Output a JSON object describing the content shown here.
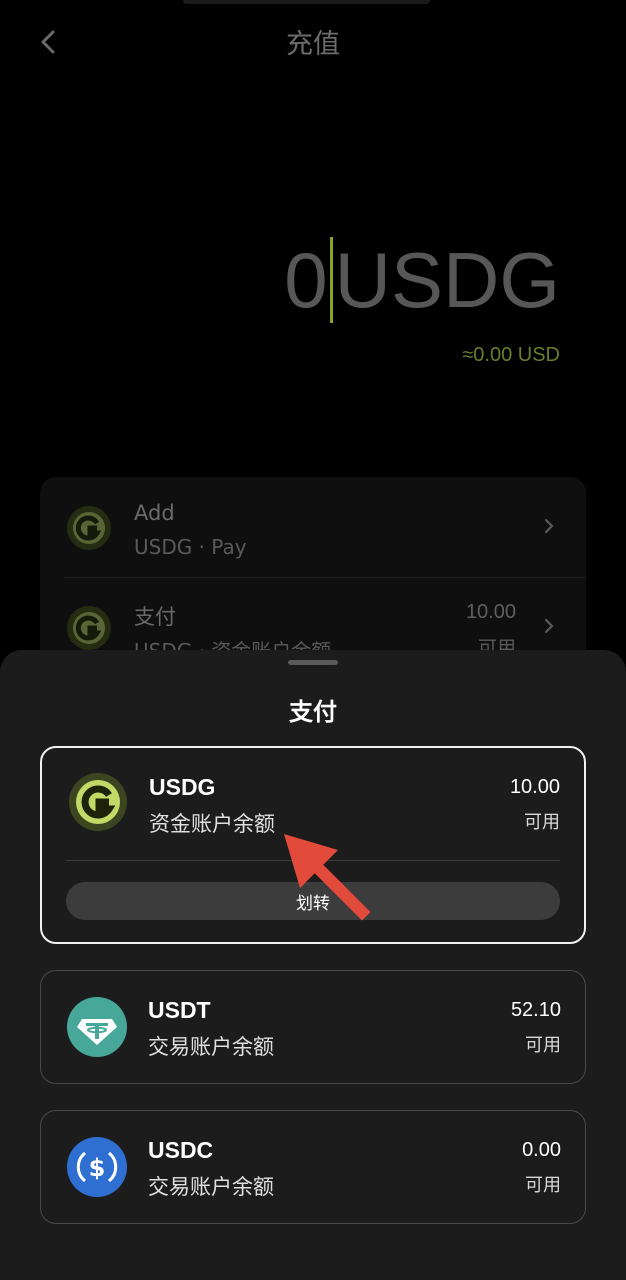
{
  "header": {
    "title": "充值"
  },
  "amount": {
    "value": "0",
    "unit": "USDG",
    "approx": "≈0.00 USD"
  },
  "methods": [
    {
      "title": "Add",
      "sub": "USDG · Pay"
    },
    {
      "title": "支付",
      "sub": "USDG · 资金账户余额",
      "amount": "10.00",
      "avail": "可用"
    }
  ],
  "sheet": {
    "title": "支付",
    "options": [
      {
        "name": "USDG",
        "sub": "资金账户余额",
        "amount": "10.00",
        "avail": "可用",
        "selected": true,
        "action": "划转"
      },
      {
        "name": "USDT",
        "sub": "交易账户余额",
        "amount": "52.10",
        "avail": "可用"
      },
      {
        "name": "USDC",
        "sub": "交易账户余额",
        "amount": "0.00",
        "avail": "可用"
      }
    ]
  },
  "colors": {
    "accent": "#8ea21c",
    "usdg_coin": "#c2d968",
    "usdt_coin": "#47a89a",
    "usdc_coin": "#2f6fd1",
    "annotation_arrow": "#e24a3b"
  },
  "icons": {
    "back": "chevron-left-icon",
    "usdg": "usdg-coin-icon",
    "usdt": "usdt-coin-icon",
    "usdc": "usdc-coin-icon",
    "chevron": "chevron-right-icon"
  }
}
